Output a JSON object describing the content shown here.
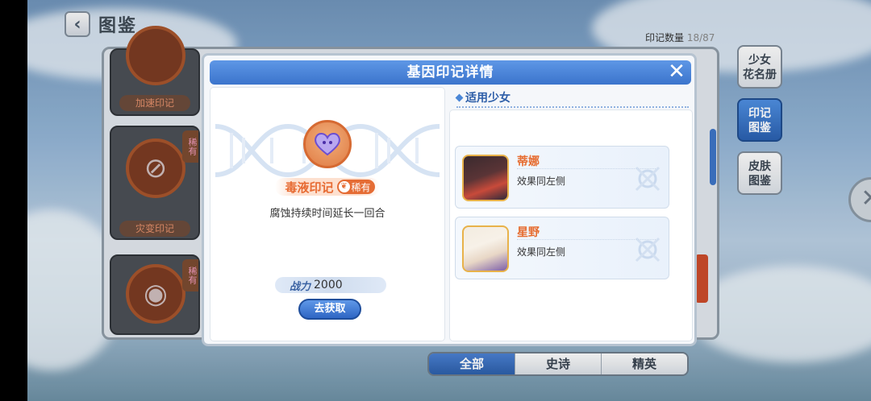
{
  "topbar": {
    "back_icon": "chevron-left-icon",
    "title": "图鉴"
  },
  "collection": {
    "label": "印记数量",
    "current": "18",
    "total": "/87"
  },
  "grid_cards": [
    {
      "name": "加速印记"
    },
    {
      "name": "灾变印记",
      "rarity": "稀有"
    },
    {
      "rarity": "稀有"
    }
  ],
  "side_tabs": [
    {
      "label": "少女\n花名册"
    },
    {
      "label": "印记\n图鉴"
    },
    {
      "label": "皮肤\n图鉴"
    }
  ],
  "bottom_tabs": [
    "全部",
    "史诗",
    "精英"
  ],
  "modal": {
    "title": "基因印记详情",
    "close_icon": "close-icon",
    "imprint": {
      "name": "毒液印记",
      "rarity": "稀有",
      "description": "腐蚀持续时间延长一回合",
      "power_label": "战力",
      "power_value": "2000",
      "acquire_button": "去获取"
    },
    "applicable": {
      "section_title": "适用少女",
      "girls": [
        {
          "name": "蒂娜",
          "effect": "效果同左侧"
        },
        {
          "name": "星野",
          "effect": "效果同左侧"
        }
      ]
    }
  },
  "colors": {
    "accent": "#3b74cc",
    "rare_orange": "#e56c34"
  }
}
